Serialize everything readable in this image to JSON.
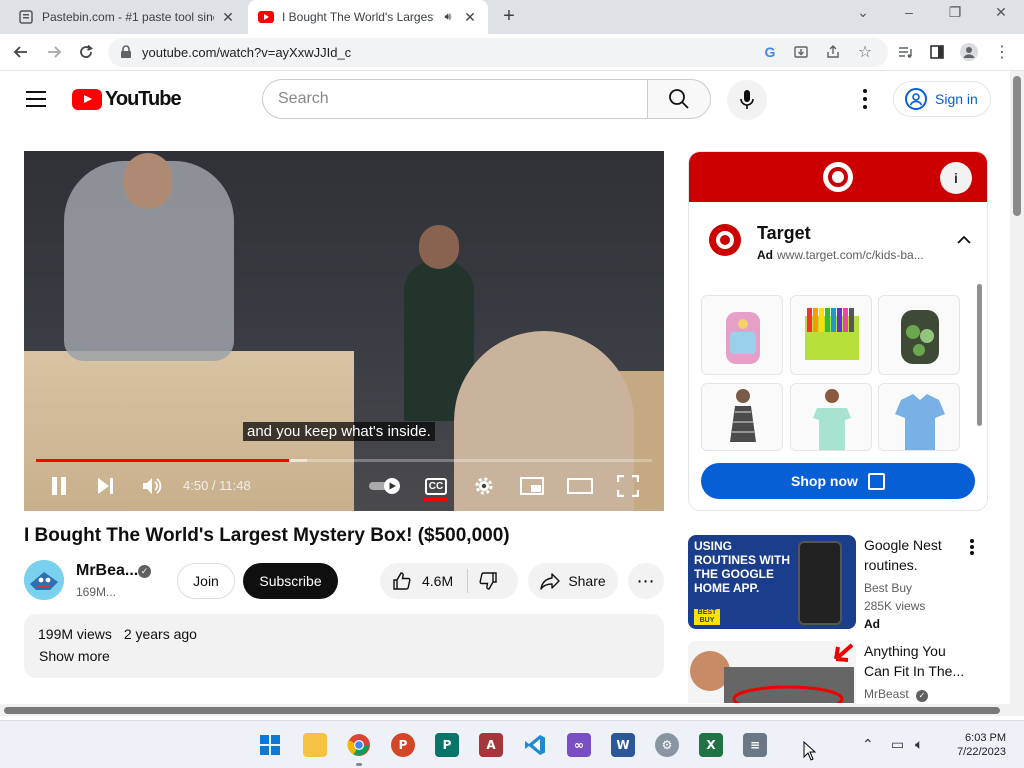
{
  "browser": {
    "tabs": [
      {
        "title": "Pastebin.com - #1 paste tool sinc"
      },
      {
        "title": "I Bought The World's Largest"
      }
    ],
    "url": "youtube.com/watch?v=ayXxwJJId_c"
  },
  "header": {
    "logo_text": "YouTube",
    "search_placeholder": "Search",
    "signin_label": "Sign in"
  },
  "player": {
    "caption": "and you keep what's inside.",
    "time_display": "4:50 / 11:48",
    "cc_label": "CC",
    "progress_played_fraction": 0.41,
    "progress_loaded_fraction": 0.44
  },
  "video": {
    "title": "I Bought The World's Largest Mystery Box! ($500,000)",
    "channel_name": "MrBea...",
    "subscribers": "169M...",
    "join_label": "Join",
    "subscribe_label": "Subscribe",
    "likes": "4.6M",
    "share_label": "Share",
    "views": "199M views",
    "age": "2 years ago",
    "show_more": "Show more"
  },
  "ad": {
    "brand": "Target",
    "ad_label": "Ad",
    "url": "www.target.com/c/kids-ba...",
    "cta": "Shop now"
  },
  "recommendations": [
    {
      "title_line1": "Google Nest",
      "title_line2": "routines.",
      "channel": "Best Buy",
      "views": "285K views",
      "badge": "Ad",
      "thumb_text": "USING ROUTINES WITH THE GOOGLE HOME APP.",
      "thumb_logo": "BEST BUY"
    },
    {
      "title_line1": "Anything You",
      "title_line2": "Can Fit In The...",
      "channel": "MrBeast"
    }
  ],
  "taskbar": {
    "time": "6:03 PM",
    "date": "7/22/2023"
  },
  "colors": {
    "youtube_red": "#ff0000",
    "target_red": "#cc0000",
    "link_blue": "#065fd4"
  }
}
